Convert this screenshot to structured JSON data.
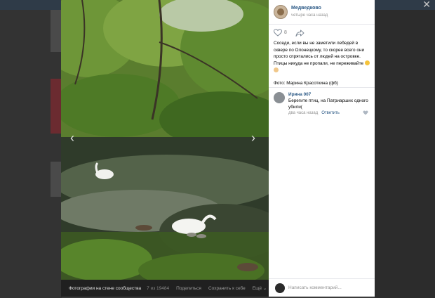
{
  "post": {
    "group_name": "Медведково",
    "time": "четыре часа назад",
    "likes": "8",
    "text_1": "Соседи, если вы не заметили лебедей в сквере по Олонецкому, то скорее всего они просто спрятались от людей на островке. Птицы никуда не пропали, не переживайте",
    "text_2": "Фото: Марина Красоткина (фб)"
  },
  "comment": {
    "author": "Ирина 007",
    "text": "Берегите птиц, на Патриарших одного убили(",
    "time": "два часа назад",
    "reply_label": "Ответить"
  },
  "composer": {
    "placeholder": "Написать комментарий..."
  },
  "photo_bar": {
    "album": "Фотографии на стене сообщества",
    "counter": "7 из 19484",
    "share": "Поделиться",
    "save": "Сохранить к себе",
    "more": "Ещё"
  },
  "colors": {
    "link": "#2a5885",
    "meta": "#939393",
    "divider": "#e7e8ec"
  },
  "icons": [
    "close-icon",
    "prev-arrow-icon",
    "next-arrow-icon",
    "like-heart-icon",
    "share-icon",
    "comment-like-icon",
    "chevron-down-icon"
  ]
}
